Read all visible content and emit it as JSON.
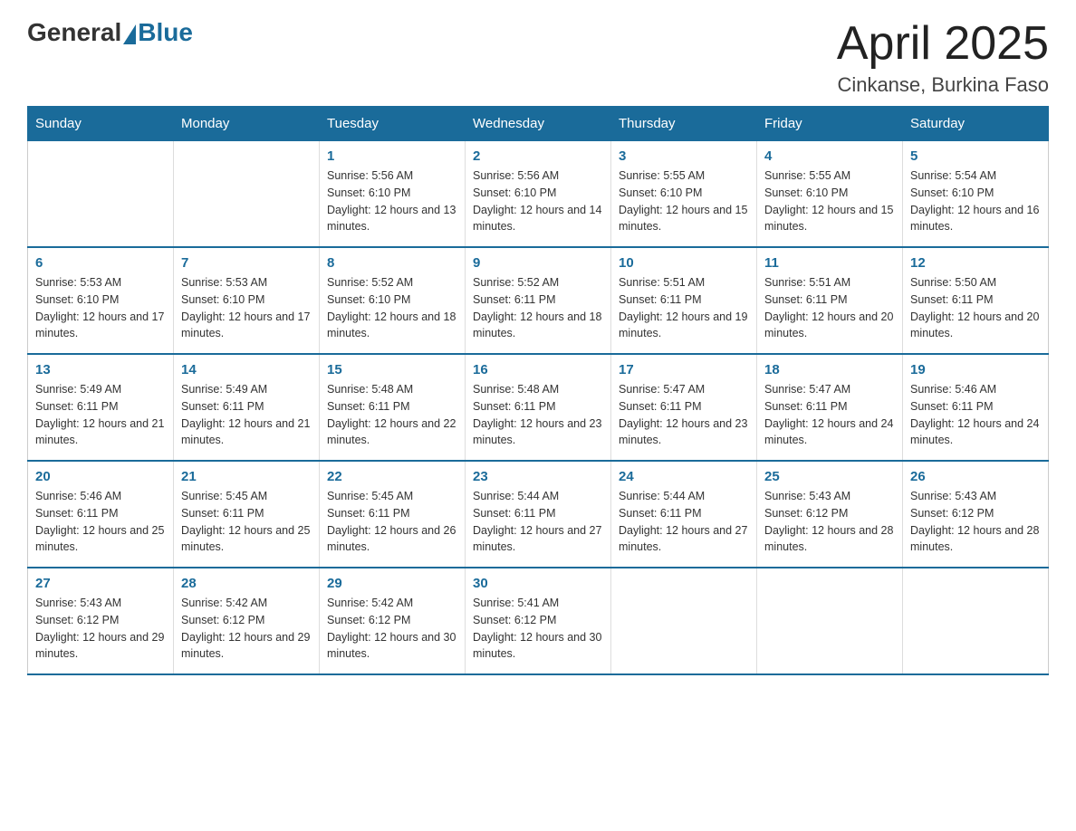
{
  "header": {
    "logo_general": "General",
    "logo_blue": "Blue",
    "month_title": "April 2025",
    "location": "Cinkanse, Burkina Faso"
  },
  "weekdays": [
    "Sunday",
    "Monday",
    "Tuesday",
    "Wednesday",
    "Thursday",
    "Friday",
    "Saturday"
  ],
  "weeks": [
    [
      {
        "day": "",
        "sunrise": "",
        "sunset": "",
        "daylight": ""
      },
      {
        "day": "",
        "sunrise": "",
        "sunset": "",
        "daylight": ""
      },
      {
        "day": "1",
        "sunrise": "Sunrise: 5:56 AM",
        "sunset": "Sunset: 6:10 PM",
        "daylight": "Daylight: 12 hours and 13 minutes."
      },
      {
        "day": "2",
        "sunrise": "Sunrise: 5:56 AM",
        "sunset": "Sunset: 6:10 PM",
        "daylight": "Daylight: 12 hours and 14 minutes."
      },
      {
        "day": "3",
        "sunrise": "Sunrise: 5:55 AM",
        "sunset": "Sunset: 6:10 PM",
        "daylight": "Daylight: 12 hours and 15 minutes."
      },
      {
        "day": "4",
        "sunrise": "Sunrise: 5:55 AM",
        "sunset": "Sunset: 6:10 PM",
        "daylight": "Daylight: 12 hours and 15 minutes."
      },
      {
        "day": "5",
        "sunrise": "Sunrise: 5:54 AM",
        "sunset": "Sunset: 6:10 PM",
        "daylight": "Daylight: 12 hours and 16 minutes."
      }
    ],
    [
      {
        "day": "6",
        "sunrise": "Sunrise: 5:53 AM",
        "sunset": "Sunset: 6:10 PM",
        "daylight": "Daylight: 12 hours and 17 minutes."
      },
      {
        "day": "7",
        "sunrise": "Sunrise: 5:53 AM",
        "sunset": "Sunset: 6:10 PM",
        "daylight": "Daylight: 12 hours and 17 minutes."
      },
      {
        "day": "8",
        "sunrise": "Sunrise: 5:52 AM",
        "sunset": "Sunset: 6:10 PM",
        "daylight": "Daylight: 12 hours and 18 minutes."
      },
      {
        "day": "9",
        "sunrise": "Sunrise: 5:52 AM",
        "sunset": "Sunset: 6:11 PM",
        "daylight": "Daylight: 12 hours and 18 minutes."
      },
      {
        "day": "10",
        "sunrise": "Sunrise: 5:51 AM",
        "sunset": "Sunset: 6:11 PM",
        "daylight": "Daylight: 12 hours and 19 minutes."
      },
      {
        "day": "11",
        "sunrise": "Sunrise: 5:51 AM",
        "sunset": "Sunset: 6:11 PM",
        "daylight": "Daylight: 12 hours and 20 minutes."
      },
      {
        "day": "12",
        "sunrise": "Sunrise: 5:50 AM",
        "sunset": "Sunset: 6:11 PM",
        "daylight": "Daylight: 12 hours and 20 minutes."
      }
    ],
    [
      {
        "day": "13",
        "sunrise": "Sunrise: 5:49 AM",
        "sunset": "Sunset: 6:11 PM",
        "daylight": "Daylight: 12 hours and 21 minutes."
      },
      {
        "day": "14",
        "sunrise": "Sunrise: 5:49 AM",
        "sunset": "Sunset: 6:11 PM",
        "daylight": "Daylight: 12 hours and 21 minutes."
      },
      {
        "day": "15",
        "sunrise": "Sunrise: 5:48 AM",
        "sunset": "Sunset: 6:11 PM",
        "daylight": "Daylight: 12 hours and 22 minutes."
      },
      {
        "day": "16",
        "sunrise": "Sunrise: 5:48 AM",
        "sunset": "Sunset: 6:11 PM",
        "daylight": "Daylight: 12 hours and 23 minutes."
      },
      {
        "day": "17",
        "sunrise": "Sunrise: 5:47 AM",
        "sunset": "Sunset: 6:11 PM",
        "daylight": "Daylight: 12 hours and 23 minutes."
      },
      {
        "day": "18",
        "sunrise": "Sunrise: 5:47 AM",
        "sunset": "Sunset: 6:11 PM",
        "daylight": "Daylight: 12 hours and 24 minutes."
      },
      {
        "day": "19",
        "sunrise": "Sunrise: 5:46 AM",
        "sunset": "Sunset: 6:11 PM",
        "daylight": "Daylight: 12 hours and 24 minutes."
      }
    ],
    [
      {
        "day": "20",
        "sunrise": "Sunrise: 5:46 AM",
        "sunset": "Sunset: 6:11 PM",
        "daylight": "Daylight: 12 hours and 25 minutes."
      },
      {
        "day": "21",
        "sunrise": "Sunrise: 5:45 AM",
        "sunset": "Sunset: 6:11 PM",
        "daylight": "Daylight: 12 hours and 25 minutes."
      },
      {
        "day": "22",
        "sunrise": "Sunrise: 5:45 AM",
        "sunset": "Sunset: 6:11 PM",
        "daylight": "Daylight: 12 hours and 26 minutes."
      },
      {
        "day": "23",
        "sunrise": "Sunrise: 5:44 AM",
        "sunset": "Sunset: 6:11 PM",
        "daylight": "Daylight: 12 hours and 27 minutes."
      },
      {
        "day": "24",
        "sunrise": "Sunrise: 5:44 AM",
        "sunset": "Sunset: 6:11 PM",
        "daylight": "Daylight: 12 hours and 27 minutes."
      },
      {
        "day": "25",
        "sunrise": "Sunrise: 5:43 AM",
        "sunset": "Sunset: 6:12 PM",
        "daylight": "Daylight: 12 hours and 28 minutes."
      },
      {
        "day": "26",
        "sunrise": "Sunrise: 5:43 AM",
        "sunset": "Sunset: 6:12 PM",
        "daylight": "Daylight: 12 hours and 28 minutes."
      }
    ],
    [
      {
        "day": "27",
        "sunrise": "Sunrise: 5:43 AM",
        "sunset": "Sunset: 6:12 PM",
        "daylight": "Daylight: 12 hours and 29 minutes."
      },
      {
        "day": "28",
        "sunrise": "Sunrise: 5:42 AM",
        "sunset": "Sunset: 6:12 PM",
        "daylight": "Daylight: 12 hours and 29 minutes."
      },
      {
        "day": "29",
        "sunrise": "Sunrise: 5:42 AM",
        "sunset": "Sunset: 6:12 PM",
        "daylight": "Daylight: 12 hours and 30 minutes."
      },
      {
        "day": "30",
        "sunrise": "Sunrise: 5:41 AM",
        "sunset": "Sunset: 6:12 PM",
        "daylight": "Daylight: 12 hours and 30 minutes."
      },
      {
        "day": "",
        "sunrise": "",
        "sunset": "",
        "daylight": ""
      },
      {
        "day": "",
        "sunrise": "",
        "sunset": "",
        "daylight": ""
      },
      {
        "day": "",
        "sunrise": "",
        "sunset": "",
        "daylight": ""
      }
    ]
  ]
}
